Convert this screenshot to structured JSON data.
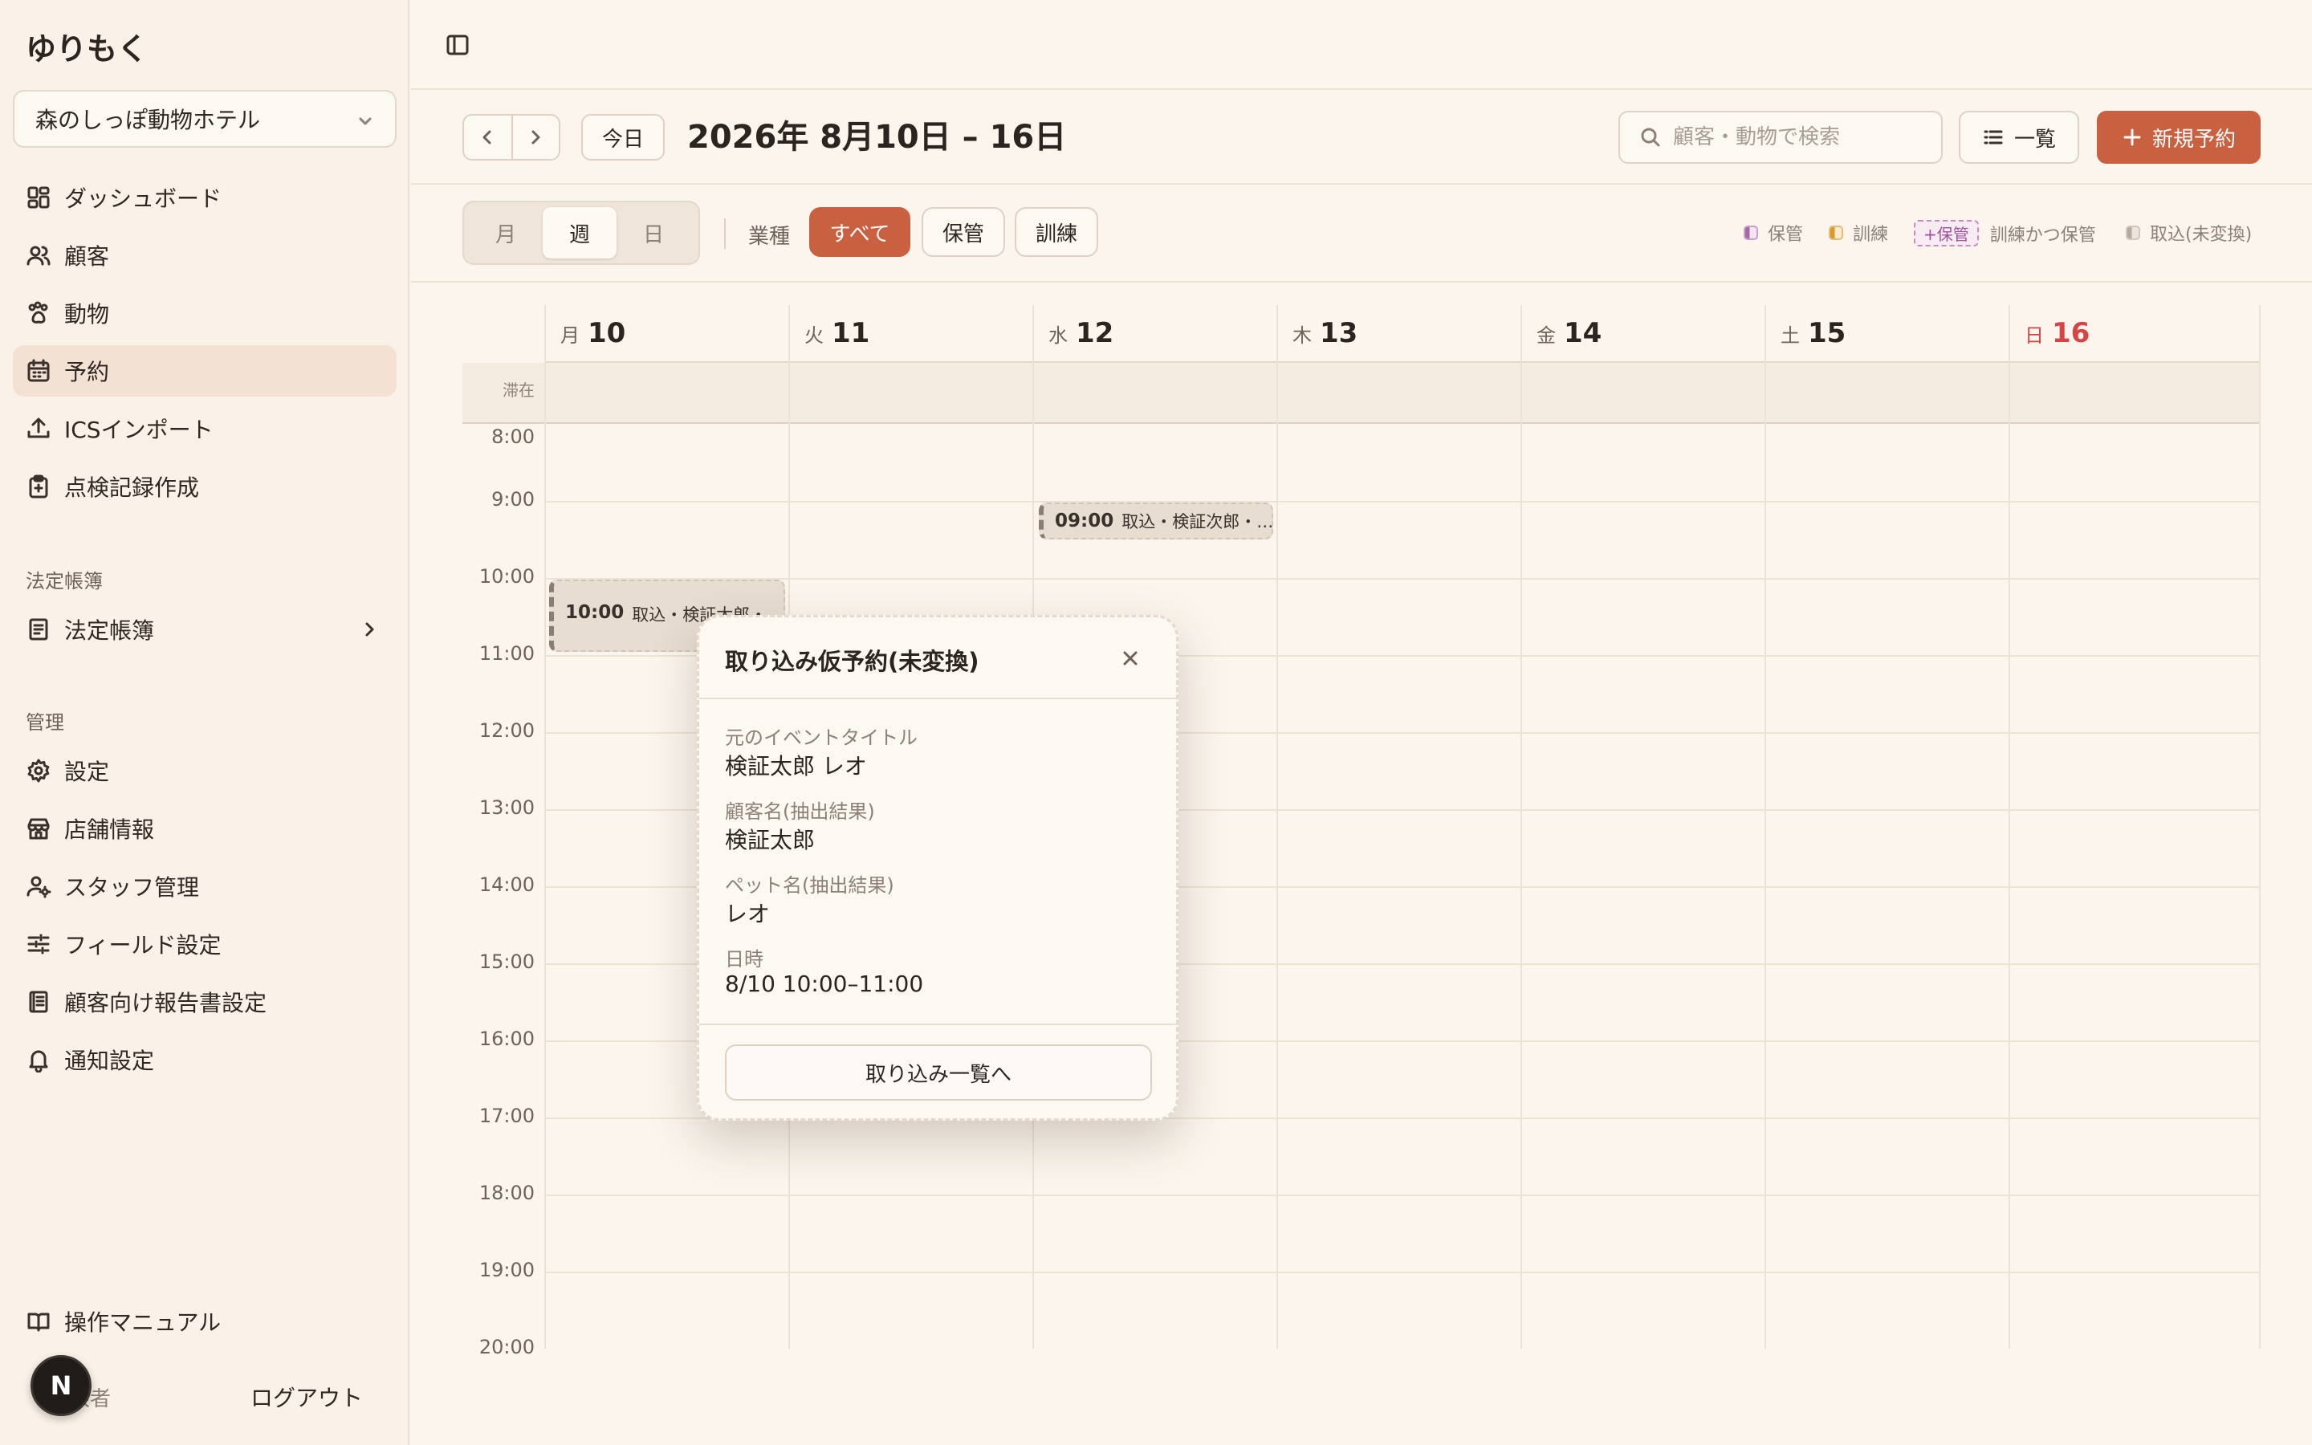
{
  "app": {
    "brand": "ゆりもく"
  },
  "sidebar": {
    "store": "森のしっぽ動物ホテル",
    "items": [
      {
        "label": "ダッシュボード",
        "icon": "dashboard-icon"
      },
      {
        "label": "顧客",
        "icon": "users-icon"
      },
      {
        "label": "動物",
        "icon": "paw-icon"
      },
      {
        "label": "予約",
        "icon": "calendar-icon",
        "active": true
      },
      {
        "label": "ICSインポート",
        "icon": "upload-icon"
      },
      {
        "label": "点検記録作成",
        "icon": "clipboard-icon"
      }
    ],
    "section_legal": "法定帳簿",
    "legal_item": "法定帳簿",
    "section_manage": "管理",
    "manage_items": [
      {
        "label": "設定",
        "icon": "gear-icon"
      },
      {
        "label": "店舗情報",
        "icon": "store-icon"
      },
      {
        "label": "スタッフ管理",
        "icon": "staff-icon"
      },
      {
        "label": "フィールド設定",
        "icon": "sliders-icon"
      },
      {
        "label": "顧客向け報告書設定",
        "icon": "report-icon"
      },
      {
        "label": "通知設定",
        "icon": "bell-icon"
      }
    ],
    "manual": "操作マニュアル",
    "avatar_initial": "N",
    "account_name": "権限者",
    "logout": "ログアウト"
  },
  "header": {
    "today": "今日",
    "range_title": "2026年 8月10日 – 16日",
    "search_placeholder": "顧客・動物で検索",
    "list_button": "一覧",
    "new_button": "新規予約"
  },
  "filter": {
    "views": [
      "月",
      "週",
      "日"
    ],
    "active_view": "週",
    "type_label": "業種",
    "chips": [
      "すべて",
      "保管",
      "訓練"
    ],
    "active_chip": "すべて",
    "legend": {
      "storage": "保管",
      "training": "訓練",
      "combo_tag": "+保管",
      "combo": "訓練かつ保管",
      "import": "取込(未変換)"
    },
    "colors": {
      "accent": "#c9603f",
      "storage": "#a56aa5",
      "training": "#d99a2b",
      "import": "#b5aaa0"
    }
  },
  "calendar": {
    "days": [
      {
        "wd": "月",
        "d": "10"
      },
      {
        "wd": "火",
        "d": "11"
      },
      {
        "wd": "水",
        "d": "12"
      },
      {
        "wd": "木",
        "d": "13"
      },
      {
        "wd": "金",
        "d": "14"
      },
      {
        "wd": "土",
        "d": "15"
      },
      {
        "wd": "日",
        "d": "16"
      }
    ],
    "stay_label": "滞在",
    "hours": [
      "8:00",
      "9:00",
      "10:00",
      "11:00",
      "12:00",
      "13:00",
      "14:00",
      "15:00",
      "16:00",
      "17:00",
      "18:00",
      "19:00",
      "20:00"
    ],
    "events": [
      {
        "time": "10:00",
        "title": "取込・検証太郎・…"
      },
      {
        "time": "09:00",
        "title": "取込・検証次郎・…"
      }
    ]
  },
  "popover": {
    "title": "取り込み仮予約(未変換)",
    "fields": [
      {
        "k": "元のイベントタイトル",
        "v": "検証太郎 レオ"
      },
      {
        "k": "顧客名(抽出結果)",
        "v": "検証太郎"
      },
      {
        "k": "ペット名(抽出結果)",
        "v": "レオ"
      },
      {
        "k": "日時",
        "v": "8/10 10:00–11:00"
      }
    ],
    "button": "取り込み一覧へ"
  }
}
